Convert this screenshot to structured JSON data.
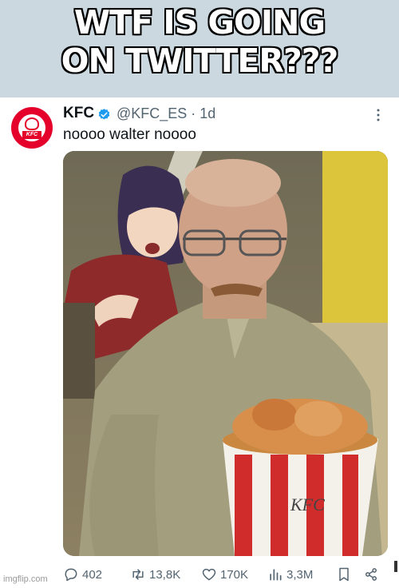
{
  "meme": {
    "caption_line1": "WTF IS GOING",
    "caption_line2": "ON TWITTER???"
  },
  "tweet": {
    "author_name": "KFC",
    "handle_time": "@KFC_ES · 1d",
    "text": "noooo walter noooo",
    "avatar_label": "KFC",
    "bucket_label": "KFC",
    "more_icon": "more-dots-icon"
  },
  "actions": {
    "replies": "402",
    "retweets": "13,8K",
    "likes": "170K",
    "views": "3,3M"
  },
  "watermark": "imgflip.com",
  "colors": {
    "kfc_red": "#e4002b",
    "verified_blue": "#1d9bf0",
    "text_secondary": "#536471",
    "header_bg": "#ccd8e0"
  }
}
